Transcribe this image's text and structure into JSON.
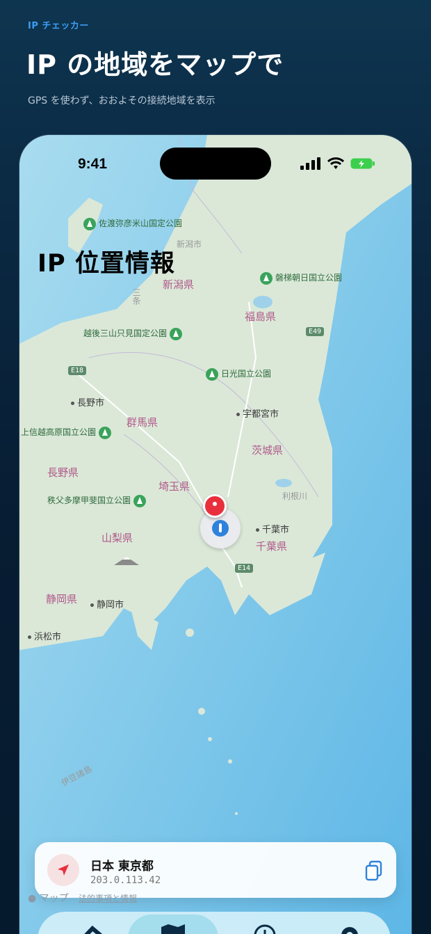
{
  "promo": {
    "kicker": "IP チェッカー",
    "headline": "IP の地域をマップで",
    "subline": "GPS を使わず、おおよその接続地域を表示"
  },
  "status_bar": {
    "time": "9:41",
    "icons": [
      "signal-icon",
      "wifi-icon",
      "battery-charging-icon"
    ]
  },
  "screen": {
    "title": "IP 位置情報"
  },
  "map": {
    "prefectures": [
      "新潟県",
      "福島県",
      "群馬県",
      "茨城県",
      "長野県",
      "埼玉県",
      "山梨県",
      "千葉県",
      "静岡県"
    ],
    "cities": [
      "新潟市",
      "長野市",
      "宇都宮市",
      "千葉市",
      "静岡市",
      "浜松市"
    ],
    "parks": [
      "佐渡弥彦米山国定公園",
      "磐梯朝日国立公園",
      "越後三山只見国定公園",
      "日光国立公園",
      "上信越高原国立公園",
      "秩父多摩甲斐国立公園"
    ],
    "roads": [
      "E18",
      "E49",
      "E14"
    ],
    "small": [
      "三条",
      "利根川",
      "伊豆諸島"
    ]
  },
  "location_card": {
    "place": "日本 東京都",
    "ip": "203.0.113.42"
  },
  "attribution": {
    "brand": "マップ",
    "legal": "法的事項と情報"
  },
  "tabs": [
    "home",
    "map",
    "history",
    "settings"
  ],
  "colors": {
    "accent": "#2f82db",
    "pin": "#e8303d",
    "kicker": "#3d9df3"
  }
}
